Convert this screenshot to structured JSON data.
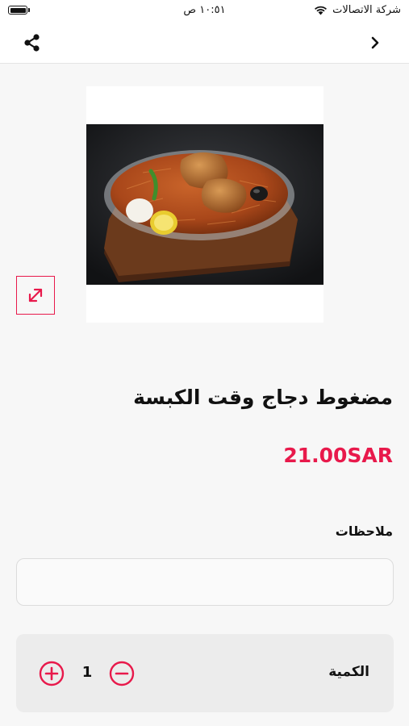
{
  "status_bar": {
    "time": "١٠:٥١ ص",
    "carrier": "شركة الاتصالات",
    "battery_level": 1.0,
    "icons": [
      "battery-icon",
      "wifi-icon"
    ]
  },
  "nav": {
    "icons": [
      "share-icon",
      "chevron-right-icon"
    ]
  },
  "product": {
    "image_subject": "chicken kabsa rice platter",
    "expand_icon": "expand-icon",
    "name": "مضغوط دجاج وقت الكبسة",
    "price": "21.00SAR"
  },
  "notes": {
    "label": "ملاحظات",
    "value": "",
    "placeholder": ""
  },
  "quantity": {
    "label": "الكمية",
    "value": "1",
    "icons": [
      "plus-circle-icon",
      "minus-circle-icon"
    ]
  },
  "colors": {
    "accent": "#e8194b",
    "background": "#f7f7f7",
    "text": "#111111"
  }
}
